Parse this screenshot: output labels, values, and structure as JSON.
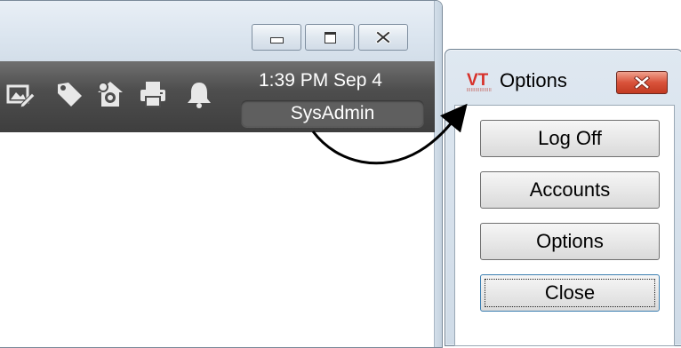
{
  "main_window": {
    "status": {
      "time": "1:39 PM  Sep 4",
      "user": "SysAdmin"
    },
    "window_controls": [
      "minimize",
      "maximize",
      "close"
    ],
    "toolbar_icons": [
      "image-edit-icon",
      "tag-icon",
      "home-settings-icon",
      "printer-icon",
      "bell-icon"
    ]
  },
  "dialog": {
    "logo_text": "VT",
    "title": "Options",
    "buttons": {
      "log_off": "Log Off",
      "accounts": "Accounts",
      "options": "Options",
      "close": "Close"
    }
  },
  "colors": {
    "toolbar": "#4e4e4e",
    "dialog_close": "#d9523a",
    "logo_red": "#d7312a"
  }
}
